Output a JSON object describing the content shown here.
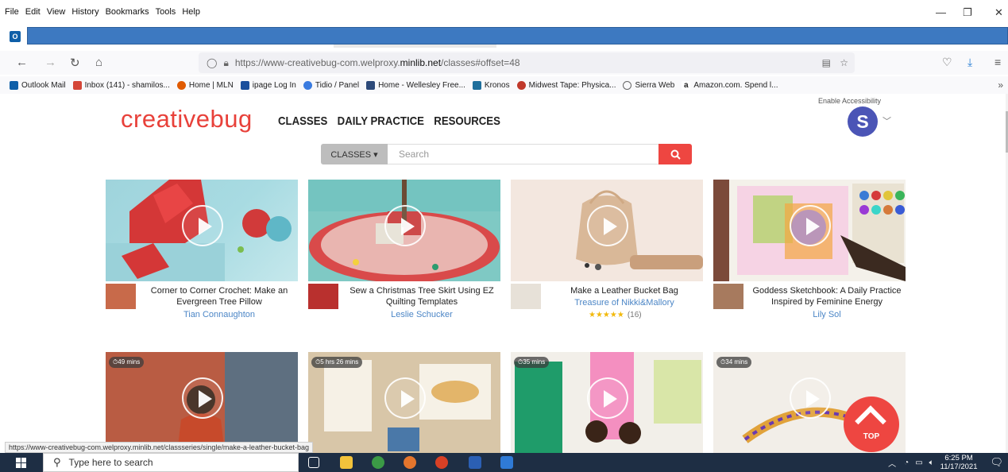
{
  "menubar": {
    "items": [
      "File",
      "Edit",
      "View",
      "History",
      "Bookmarks",
      "Tools",
      "Help"
    ]
  },
  "outlook": {
    "icon": "outlook-icon",
    "label": "O"
  },
  "navbar": {
    "url_prefix": "https://www-creativebug-com.welproxy.",
    "url_domain": "minlib.net",
    "url_suffix": "/classes#offset=48"
  },
  "bookmarks": [
    {
      "label": "Outlook Mail",
      "color": "#0f5fa8"
    },
    {
      "label": "Inbox (141) - shamilos...",
      "color": "#d44638"
    },
    {
      "label": "Home | MLN",
      "color": "#e05a00"
    },
    {
      "label": "ipage Log In",
      "color": "#1b4f9c"
    },
    {
      "label": "Tidio / Panel",
      "color": "#3a7be0"
    },
    {
      "label": "Home - Wellesley Free...",
      "color": "#2d4a7a"
    },
    {
      "label": "Kronos",
      "color": "#1f6f9c"
    },
    {
      "label": "Midwest Tape: Physica...",
      "color": "#c0392b"
    },
    {
      "label": "Sierra Web",
      "color": "#666666"
    },
    {
      "label": "Amazon.com. Spend l...",
      "color": "#222222"
    }
  ],
  "site": {
    "logo": "creativebug",
    "nav": [
      "CLASSES",
      "DAILY PRACTICE",
      "RESOURCES"
    ],
    "enable_accessibility": "Enable Accessibility",
    "avatar_letter": "S",
    "search": {
      "select_label": "CLASSES ▾",
      "placeholder": "Search"
    },
    "top_label": "TOP"
  },
  "cards_row1": [
    {
      "title": "Corner to Corner Crochet: Make an Evergreen Tree Pillow",
      "author": "Tian Connaughton"
    },
    {
      "title": "Sew a Christmas Tree Skirt Using EZ Quilting Templates",
      "author": "Leslie Schucker"
    },
    {
      "title": "Make a Leather Bucket Bag",
      "author": "Treasure of Nikki&Mallory",
      "stars": "★★★★★",
      "rating_count": "(16)"
    },
    {
      "title": "Goddess Sketchbook: A Daily Practice Inspired by Feminine Energy",
      "author": "Lily Sol"
    }
  ],
  "cards_row2": [
    {
      "duration": "⏱49 mins"
    },
    {
      "duration": "⏱5 hrs 26 mins"
    },
    {
      "duration": "⏱35 mins"
    },
    {
      "duration": "⏱34 mins"
    }
  ],
  "status_url": "https://www-creativebug-com.welproxy.minlib.net/classseries/single/make-a-leather-bucket-bag",
  "taskbar": {
    "search_placeholder": "Type here to search",
    "time": "6:25 PM",
    "date": "11/17/2021"
  }
}
